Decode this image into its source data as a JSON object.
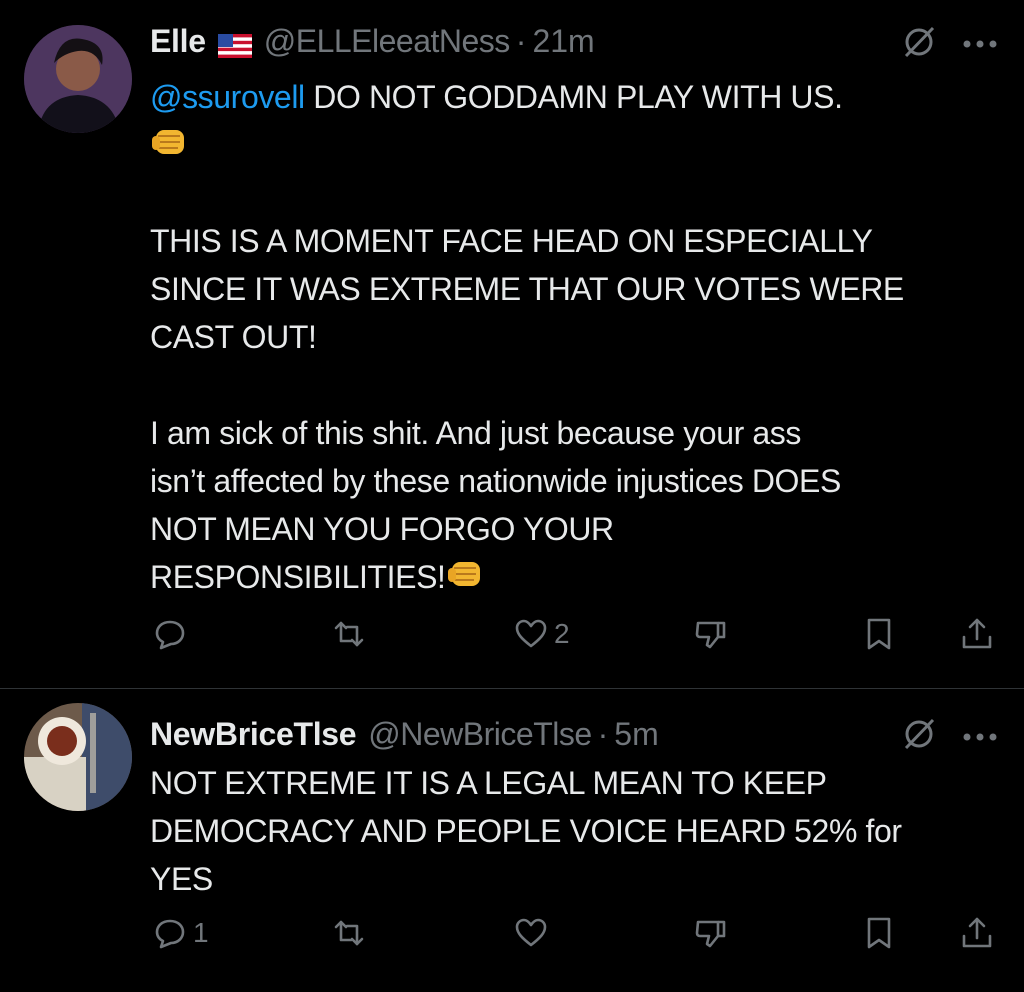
{
  "tweets": [
    {
      "display_name": "Elle",
      "handle": "@ELLEleeatNess",
      "separator": "·",
      "time": "21m",
      "mention": "@ssurovell",
      "text_after_mention": " DO NOT GODDAMN PLAY WITH US.\n",
      "text_line_2": "\n\nTHIS IS A MOMENT FACE HEAD ON ESPECIALLY\nSINCE IT WAS EXTREME THAT OUR VOTES WERE\nCAST OUT!\n\nI am sick of this shit. And just because your ass\nisn’t affected by these nationwide injustices DOES\nNOT MEAN YOU FORGO YOUR\nRESPONSIBILITIES!",
      "emoji_name": "oncoming-fist",
      "reply_count": "",
      "retweet_count": "",
      "like_count": "2"
    },
    {
      "display_name": "NewBriceTlse",
      "handle": "@NewBriceTlse",
      "separator": "·",
      "time": "5m",
      "text": "NOT EXTREME IT IS A LEGAL MEAN TO KEEP\nDEMOCRACY AND PEOPLE VOICE HEARD 52% for\nYES",
      "reply_count": "1",
      "retweet_count": "",
      "like_count": ""
    }
  ],
  "colors": {
    "background": "#000000",
    "text": "#e7e9ea",
    "secondary": "#71767b",
    "link": "#1d9bf0",
    "divider": "#2f3336"
  },
  "icons": [
    "reply-icon",
    "retweet-icon",
    "like-icon",
    "dislike-icon",
    "bookmark-icon",
    "share-icon",
    "grok-icon",
    "more-icon",
    "us-flag-icon"
  ]
}
